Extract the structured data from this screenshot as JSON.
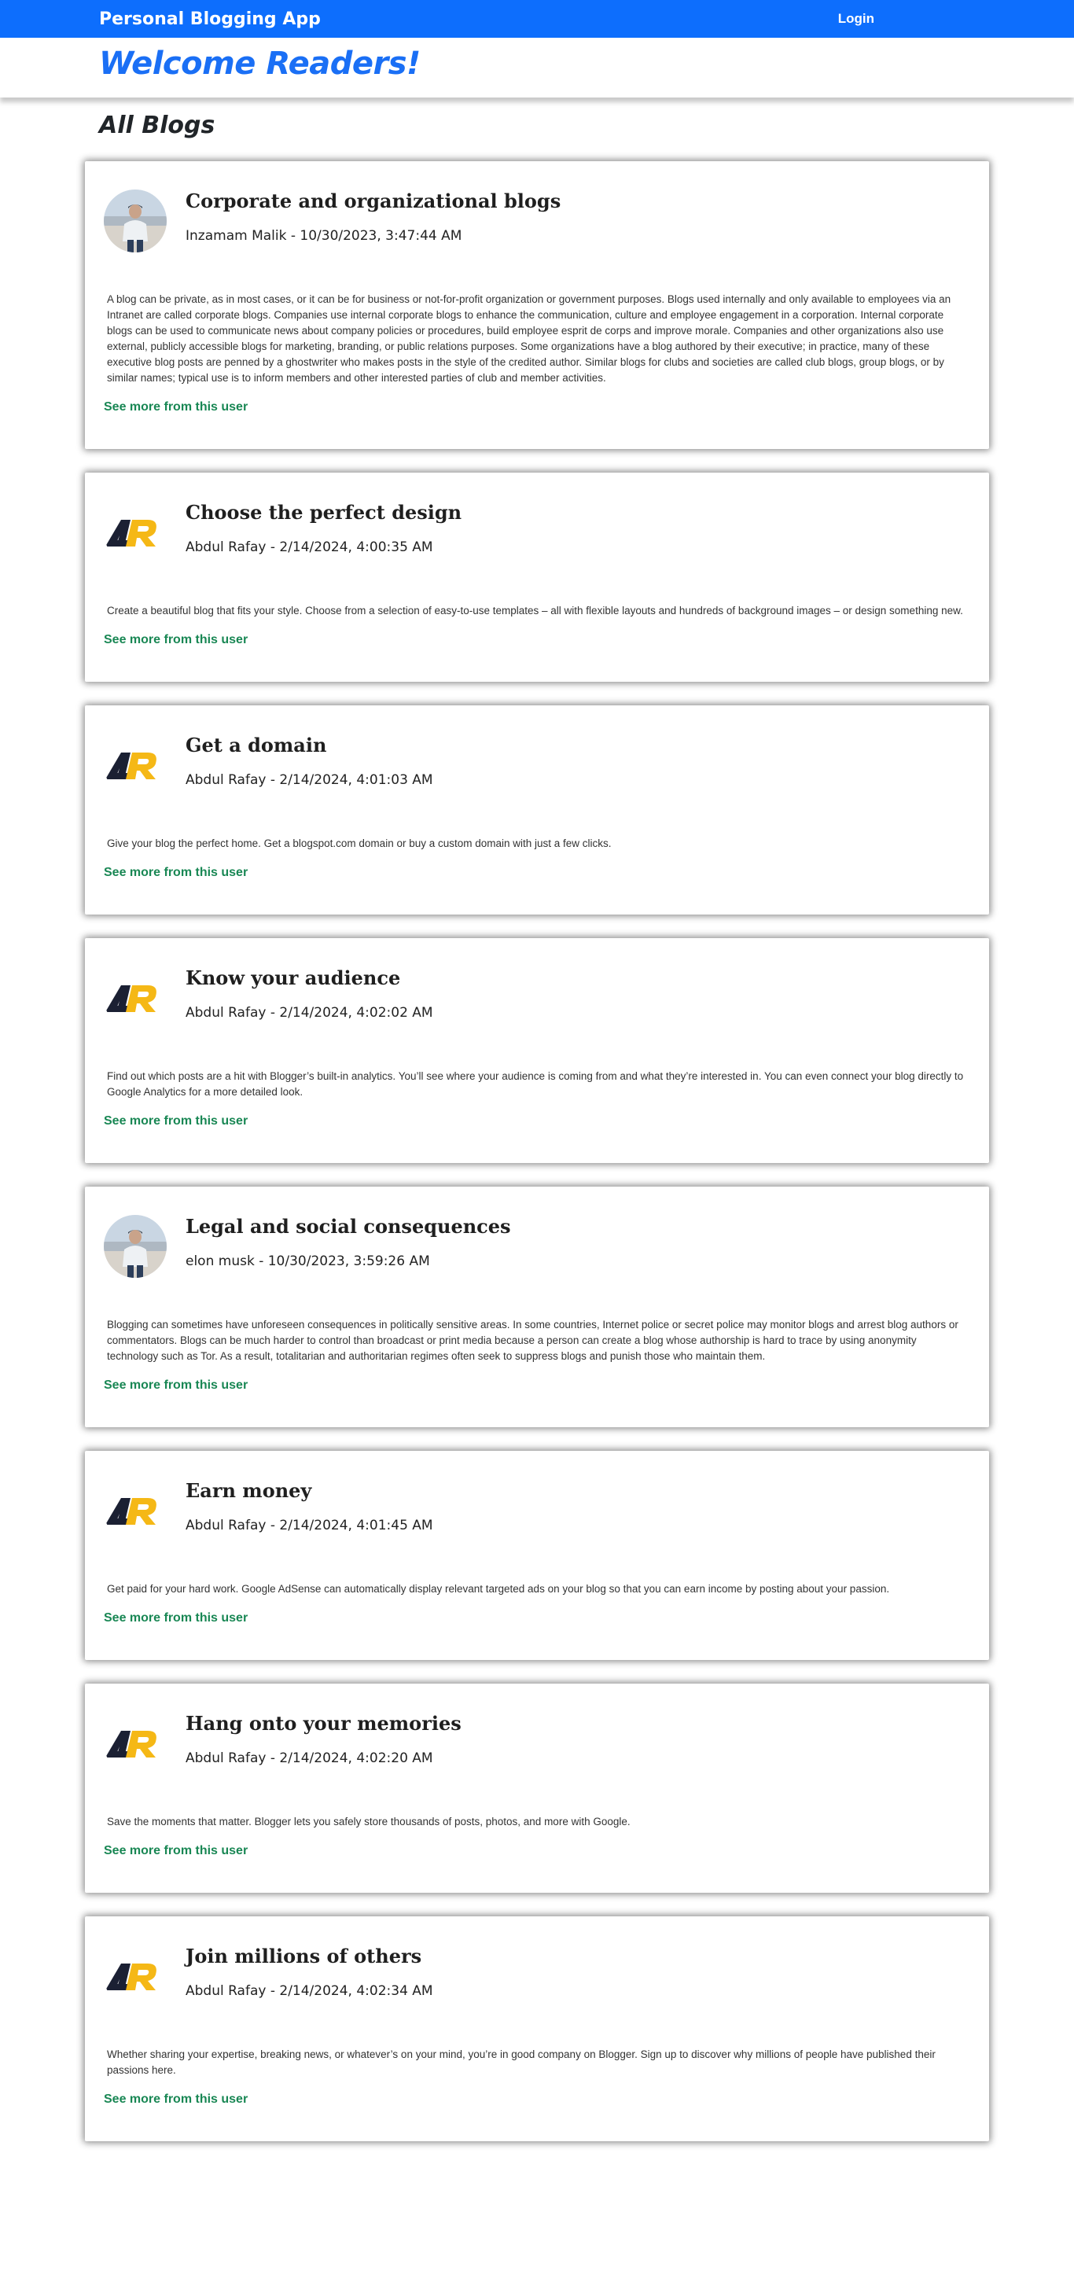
{
  "header": {
    "brand": "Personal Blogging App",
    "login": "Login",
    "welcome": "Welcome Readers!"
  },
  "section_title": "All Blogs",
  "see_more_label": "See more from this user",
  "colors": {
    "primary": "#0d6efd",
    "welcome": "#1a6ff5",
    "link": "#198754",
    "logo_dark": "#1b2033",
    "logo_yellow": "#f5b816"
  },
  "blogs": [
    {
      "title": "Corporate and organizational blogs",
      "meta": "Inzamam Malik - 10/30/2023, 3:47:44 AM",
      "avatar": "photo",
      "body": "A blog can be private, as in most cases, or it can be for business or not-for-profit organization or government purposes. Blogs used internally and only available to employees via an Intranet are called corporate blogs. Companies use internal corporate blogs to enhance the communication, culture and employee engagement in a corporation. Internal corporate blogs can be used to communicate news about company policies or procedures, build employee esprit de corps and improve morale. Companies and other organizations also use external, publicly accessible blogs for marketing, branding, or public relations purposes. Some organizations have a blog authored by their executive; in practice, many of these executive blog posts are penned by a ghostwriter who makes posts in the style of the credited author. Similar blogs for clubs and societies are called club blogs, group blogs, or by similar names; typical use is to inform members and other interested parties of club and member activities."
    },
    {
      "title": "Choose the perfect design",
      "meta": "Abdul Rafay - 2/14/2024, 4:00:35 AM",
      "avatar": "logo",
      "body": "Create a beautiful blog that fits your style. Choose from a selection of easy-to-use templates – all with flexible layouts and hundreds of background images – or design something new."
    },
    {
      "title": "Get a domain",
      "meta": "Abdul Rafay - 2/14/2024, 4:01:03 AM",
      "avatar": "logo",
      "body": "Give your blog the perfect home. Get a blogspot.com domain or buy a custom domain with just a few clicks."
    },
    {
      "title": "Know your audience",
      "meta": "Abdul Rafay - 2/14/2024, 4:02:02 AM",
      "avatar": "logo",
      "body": "Find out which posts are a hit with Blogger’s built-in analytics. You’ll see where your audience is coming from and what they’re interested in. You can even connect your blog directly to Google Analytics for a more detailed look."
    },
    {
      "title": "Legal and social consequences",
      "meta": "elon musk - 10/30/2023, 3:59:26 AM",
      "avatar": "photo",
      "body": "Blogging can sometimes have unforeseen consequences in politically sensitive areas. In some countries, Internet police or secret police may monitor blogs and arrest blog authors or commentators. Blogs can be much harder to control than broadcast or print media because a person can create a blog whose authorship is hard to trace by using anonymity technology such as Tor. As a result, totalitarian and authoritarian regimes often seek to suppress blogs and punish those who maintain them."
    },
    {
      "title": "Earn money",
      "meta": "Abdul Rafay - 2/14/2024, 4:01:45 AM",
      "avatar": "logo",
      "body": "Get paid for your hard work. Google AdSense can automatically display relevant targeted ads on your blog so that you can earn income by posting about your passion."
    },
    {
      "title": "Hang onto your memories",
      "meta": "Abdul Rafay - 2/14/2024, 4:02:20 AM",
      "avatar": "logo",
      "body": "Save the moments that matter. Blogger lets you safely store thousands of posts, photos, and more with Google."
    },
    {
      "title": "Join millions of others",
      "meta": "Abdul Rafay - 2/14/2024, 4:02:34 AM",
      "avatar": "logo",
      "body": "Whether sharing your expertise, breaking news, or whatever’s on your mind, you’re in good company on Blogger. Sign up to discover why millions of people have published their passions here."
    }
  ]
}
